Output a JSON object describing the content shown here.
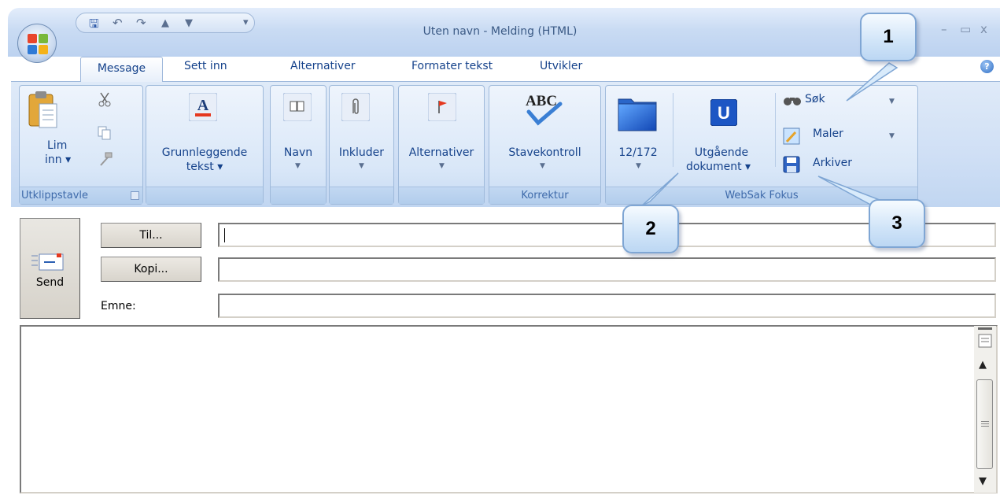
{
  "window": {
    "title": "Uten navn - Melding (HTML)",
    "controls": {
      "minimize": "–",
      "maximize": "▭",
      "close": "x"
    }
  },
  "tabs": [
    "Message",
    "Sett inn",
    "Alternativer",
    "Formater tekst",
    "Utvikler"
  ],
  "ribbon": {
    "clipboard": {
      "paste": [
        "Lim",
        "inn ▾"
      ],
      "group_label": "Utklippstavle"
    },
    "basic_text": {
      "label": [
        "Grunnleggende",
        "tekst ▾"
      ]
    },
    "names": {
      "label": "Navn"
    },
    "include": {
      "label": "Inkluder"
    },
    "options": {
      "label": "Alternativer"
    },
    "proofing": {
      "spelling": "Stavekontroll",
      "group_label": "Korrektur",
      "abc": "ABC"
    },
    "websak": {
      "counter": "12/172",
      "outgoing": [
        "Utgående",
        "dokument ▾"
      ],
      "search": "Søk",
      "templates": "Maler",
      "archive": "Arkiver",
      "group_label": "WebSak Fokus",
      "u_letter": "U"
    }
  },
  "form": {
    "send": "Send",
    "to_button": "Til...",
    "cc_button": "Kopi...",
    "subject_label": "Emne:",
    "to_value": "",
    "cc_value": "",
    "subject_value": ""
  },
  "callouts": [
    "1",
    "2",
    "3"
  ],
  "colors": {
    "ribbon_bg": "#cfdff5",
    "tab_text": "#15428b",
    "callout_border": "#7fa6d4"
  }
}
